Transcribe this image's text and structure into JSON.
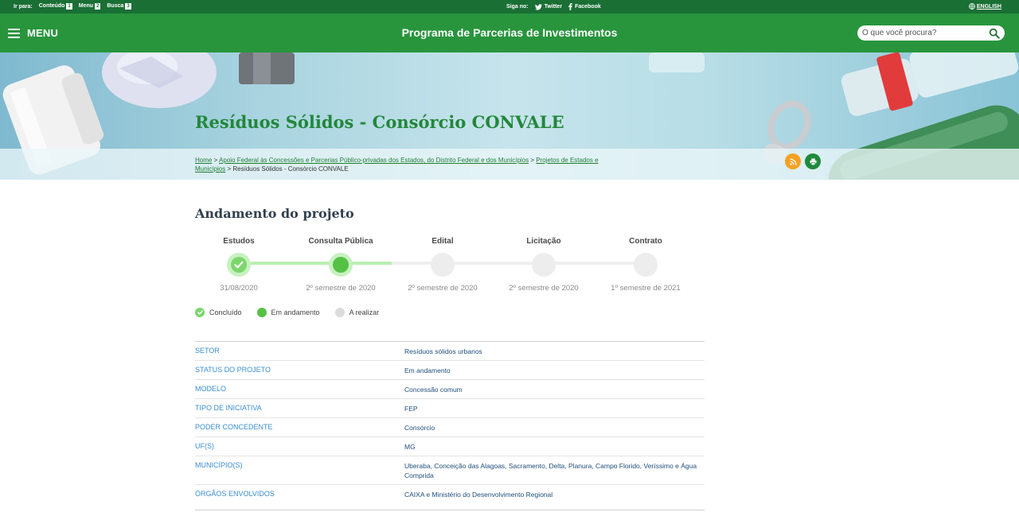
{
  "topbar": {
    "skip_label": "Ir para:",
    "skip_links": [
      {
        "label": "Conteúdo",
        "key": "1"
      },
      {
        "label": "Menu",
        "key": "2"
      },
      {
        "label": "Busca",
        "key": "3"
      }
    ],
    "follow_label": "Siga no:",
    "social": [
      {
        "label": "Twitter",
        "icon": "twitter-icon"
      },
      {
        "label": "Facebook",
        "icon": "facebook-icon"
      }
    ],
    "language_label": "ENGLISH"
  },
  "header": {
    "menu_label": "MENU",
    "site_title": "Programa de Parcerias de Investimentos",
    "search_placeholder": "O que você procura?"
  },
  "banner": {
    "page_title": "Resíduos Sólidos - Consórcio CONVALE",
    "breadcrumb": {
      "links": [
        "Home",
        "Apoio Federal às Concessões e Parcerias Público-privadas dos Estados, do Distrito Federal e dos Municípios",
        "Projetos de Estados e Municípios"
      ],
      "current": "Resíduos Sólidos - Consórcio CONVALE",
      "separator": ">"
    }
  },
  "progress": {
    "title": "Andamento do projeto",
    "stages": [
      {
        "label": "Estudos",
        "date": "31/08/2020",
        "status": "done"
      },
      {
        "label": "Consulta Pública",
        "date": "2º semestre de 2020",
        "status": "current"
      },
      {
        "label": "Edital",
        "date": "2º semestre de 2020",
        "status": "pending"
      },
      {
        "label": "Licitação",
        "date": "2º semestre de 2020",
        "status": "pending"
      },
      {
        "label": "Contrato",
        "date": "1º semestre de 2021",
        "status": "pending"
      }
    ],
    "legend": {
      "done": "Concluído",
      "current": "Em andamento",
      "pending": "A realizar"
    },
    "colors": {
      "done": "#7cd66d",
      "current": "#55c144",
      "pending": "#dcdcdc"
    }
  },
  "details": [
    {
      "key": "SETOR",
      "value": "Resíduos sólidos urbanos"
    },
    {
      "key": "STATUS DO PROJETO",
      "value": "Em andamento"
    },
    {
      "key": "MODELO",
      "value": "Concessão comum"
    },
    {
      "key": "TIPO DE INICIATIVA",
      "value": "FEP"
    },
    {
      "key": "PODER CONCEDENTE",
      "value": "Consórcio"
    },
    {
      "key": "UF(S)",
      "value": "MG"
    },
    {
      "key": "MUNICÍPIO(S)",
      "value": "Uberaba, Conceição das Alagoas, Sacramento, Delta, Planura, Campo Florido, Veríssimo e Água Comprida"
    },
    {
      "key": "ÓRGÃOS ENVOLVIDOS",
      "value": "CAIXA e Ministério do Desenvolvimento Regional"
    }
  ],
  "theme": {
    "topbar": "#1a6f35",
    "header": "#28953d",
    "title_green": "#22873a",
    "key_blue": "#3a8fd4",
    "rss_orange": "#f4a223"
  }
}
